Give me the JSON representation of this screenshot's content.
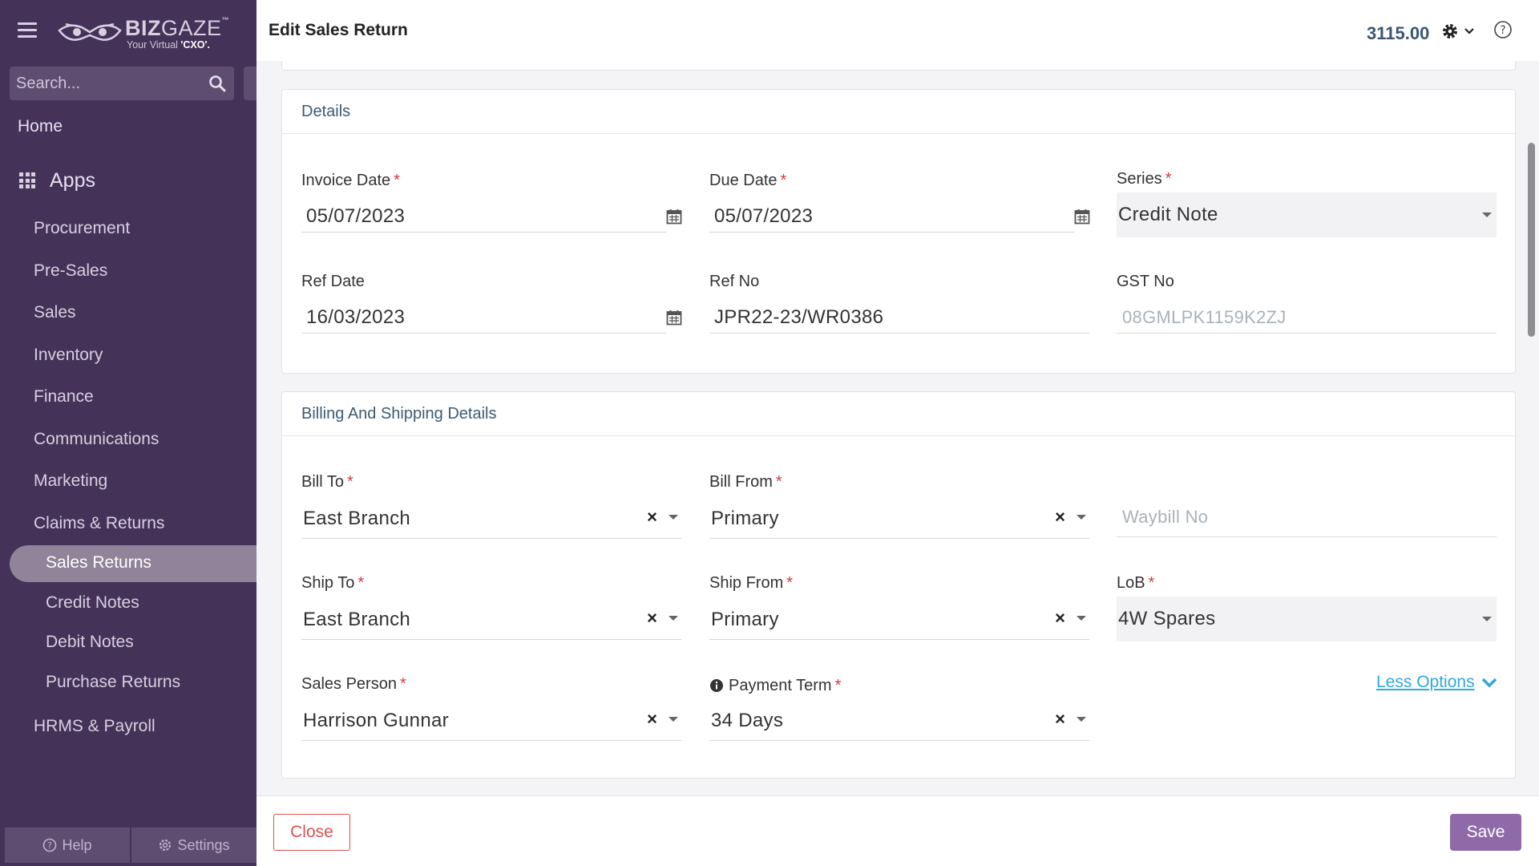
{
  "sidebar": {
    "logo": {
      "brand_bold": "BIZ",
      "brand_light": "GAZE",
      "tm": "™",
      "tagline": "Your Virtual",
      "tagline_bold": "'CXO'."
    },
    "search_placeholder": "Search...",
    "home": "Home",
    "apps": "Apps",
    "items": [
      "Procurement",
      "Pre-Sales",
      "Sales",
      "Inventory",
      "Finance",
      "Communications",
      "Marketing",
      "Claims & Returns"
    ],
    "subitems": [
      "Sales Returns",
      "Credit Notes",
      "Debit Notes",
      "Purchase Returns"
    ],
    "active_subitem": "Sales Returns",
    "hrms": "HRMS & Payroll",
    "footer": {
      "help": "Help",
      "settings": "Settings"
    }
  },
  "header": {
    "title": "Edit Sales Return",
    "amount": "3115.00"
  },
  "details": {
    "heading": "Details",
    "invoice_date": {
      "label": "Invoice Date",
      "value": "05/07/2023"
    },
    "due_date": {
      "label": "Due Date",
      "value": "05/07/2023"
    },
    "series": {
      "label": "Series",
      "value": "Credit Note"
    },
    "ref_date": {
      "label": "Ref Date",
      "value": "16/03/2023"
    },
    "ref_no": {
      "label": "Ref No",
      "value": "JPR22-23/WR0386"
    },
    "gst_no": {
      "label": "GST No",
      "placeholder": "08GMLPK1159K2ZJ"
    }
  },
  "billing": {
    "heading": "Billing And Shipping Details",
    "bill_to": {
      "label": "Bill To",
      "value": "East Branch"
    },
    "bill_from": {
      "label": "Bill From",
      "value": "Primary"
    },
    "waybill": {
      "placeholder": "Waybill No"
    },
    "ship_to": {
      "label": "Ship To",
      "value": "East Branch"
    },
    "ship_from": {
      "label": "Ship From",
      "value": "Primary"
    },
    "lob": {
      "label": "LoB",
      "value": "4W Spares"
    },
    "sales_person": {
      "label": "Sales Person",
      "value": "Harrison Gunnar"
    },
    "payment_term": {
      "label": "Payment Term",
      "value": "34 Days"
    },
    "less_options": "Less Options"
  },
  "footer": {
    "close": "Close",
    "save": "Save"
  },
  "marks": {
    "required": "*",
    "clear": "×"
  },
  "colors": {
    "sidebar": "#453258",
    "accent": "#8e6aa8",
    "required": "#d83a3a",
    "link": "#30a9dd",
    "close": "#d9534f"
  }
}
